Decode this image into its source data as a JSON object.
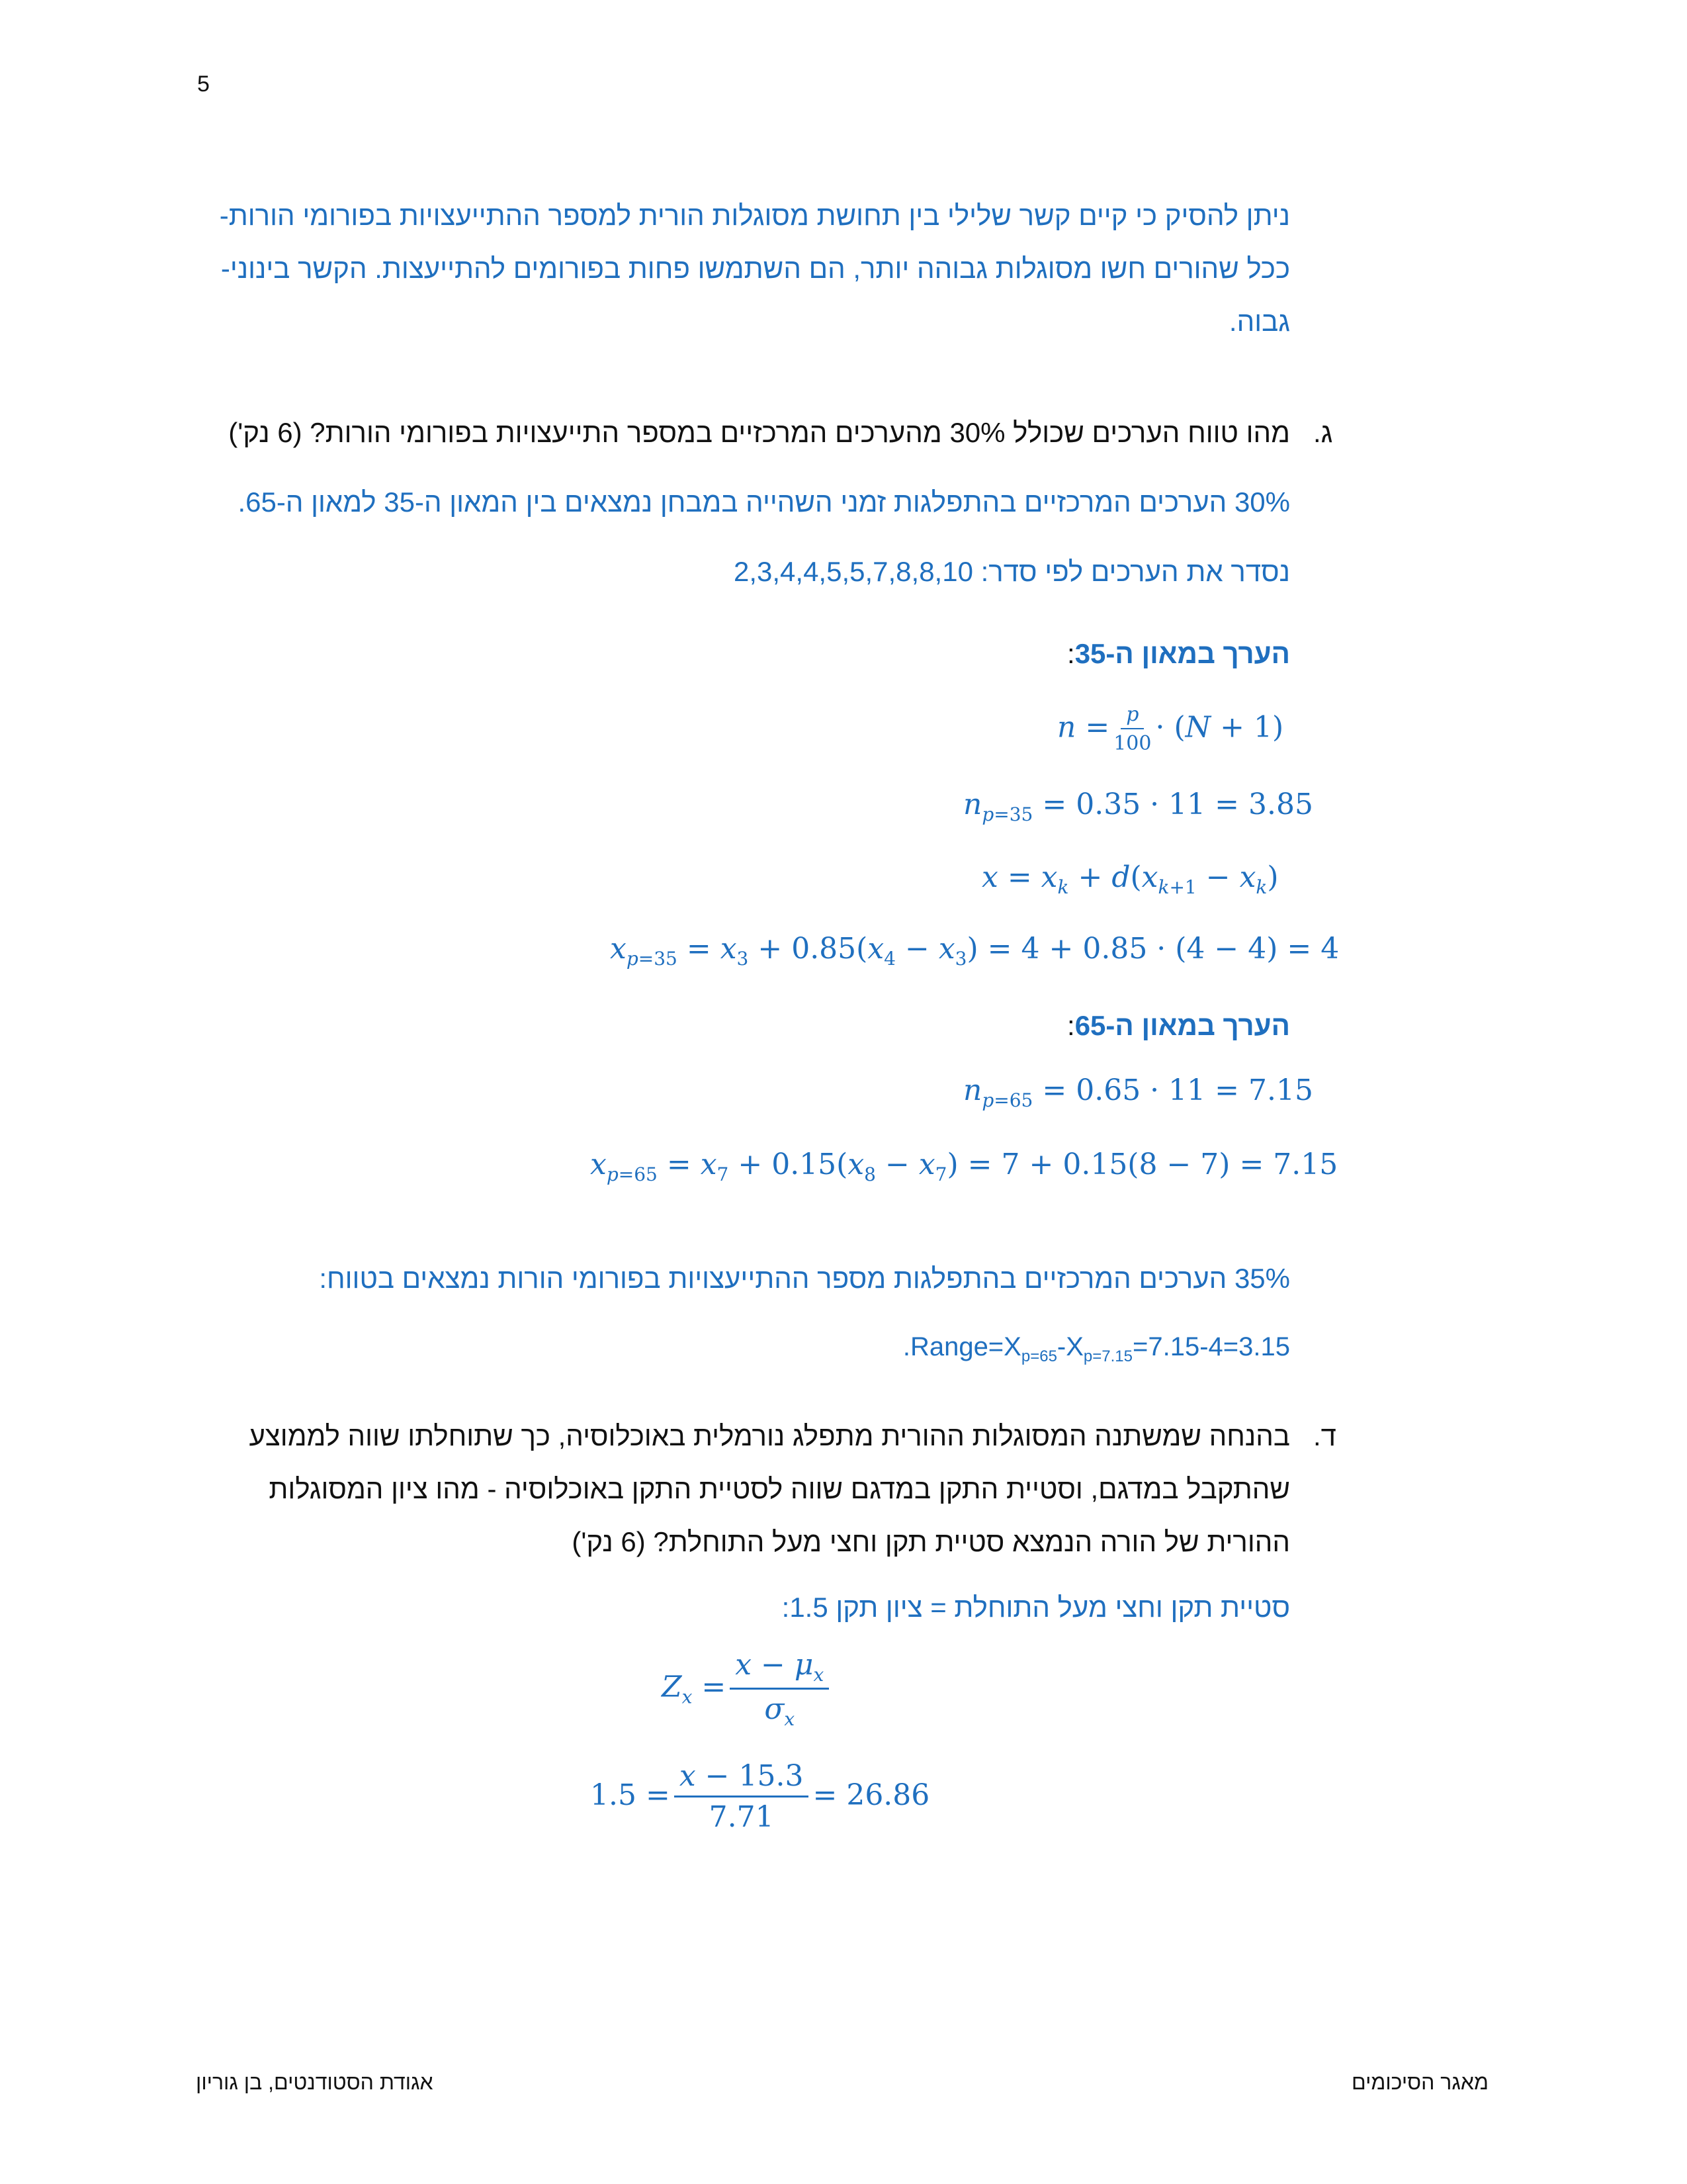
{
  "page_number": "5",
  "intro": {
    "lines": [
      "ניתן להסיק כי קיים קשר שלילי בין תחושת מסוגלות הורית למספר ההתייעצויות בפורומי הורות-",
      "ככל שהורים חשו מסוגלות גבוהה יותר, הם השתמשו פחות בפורומים להתייעצות. הקשר בינוני-",
      "גבוה."
    ]
  },
  "question_g": {
    "marker": "ג.",
    "text": "מהו טווח הערכים שכולל 30% מהערכים המרכזיים במספר התייעצויות בפורומי הורות? (6 נק')",
    "answer_line1": "30% הערכים המרכזיים בהתפלגות זמני השהייה במבחן נמצאים בין המאון ה-35 למאון ה-65.",
    "answer_line2": "נסדר את הערכים לפי סדר: 2,3,4,4,5,5,7,8,8,10",
    "heading_35": "הערך במאון ה-35",
    "heading_65": "הערך במאון ה-65",
    "colon": ":",
    "summary_line": "35% הערכים המרכזיים בהתפלגות מספר ההתייעצויות בפורומי הורות נמצאים בטווח:",
    "range": {
      "prefix": "Range=X",
      "sub1": "p=65",
      "mid": "-X",
      "sub2": "p=7.15",
      "suffix": "=7.15-4=3.15",
      "trail": "."
    }
  },
  "question_d": {
    "marker": "ד.",
    "lines": [
      "בהנחה שמשתנה המסוגלות ההורית מתפלג נורמלית באוכלוסיה, כך שתוחלתו שווה לממוצע",
      "שהתקבל במדגם, וסטיית התקן במדגם שווה לסטיית התקן באוכלוסיה - מהו ציון המסוגלות",
      "ההורית של הורה הנמצא סטיית תקן וחצי מעל התוחלת? (6 נק')"
    ],
    "answer_line": "סטיית תקן וחצי מעל התוחלת = ציון תקן 1.5:"
  },
  "footer": {
    "right": "מאגר הסיכומים",
    "left": "אגודת הסטודנטים, בן גוריון"
  },
  "colors": {
    "answer_blue": "#1f6fbf",
    "question_black": "#111111"
  }
}
